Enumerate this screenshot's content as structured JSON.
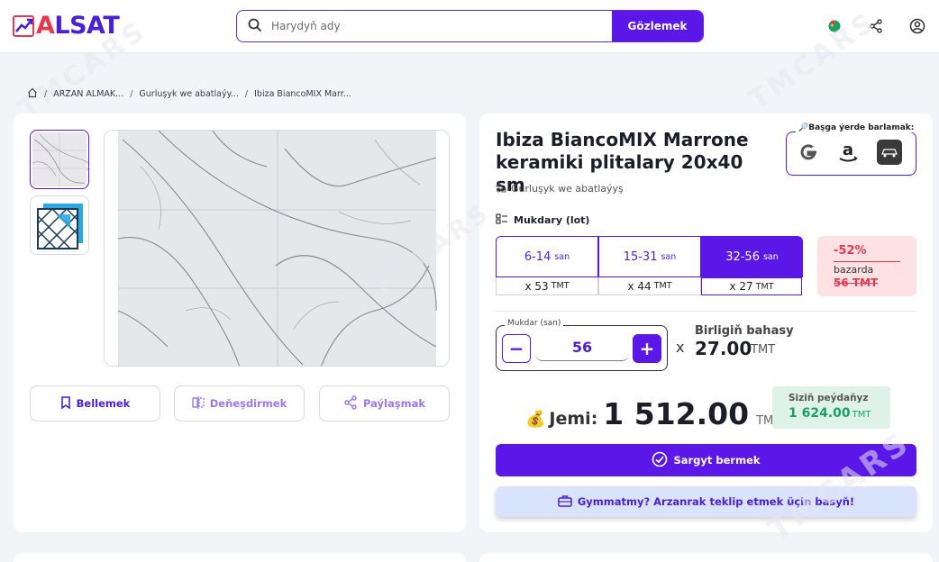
{
  "header": {
    "logo_text": "ALSAT",
    "search_placeholder": "Harydyň ady",
    "search_button": "Gözlemek",
    "brand_color": "#5a17e8",
    "accent_color": "#e63950",
    "icons": [
      "language-flag-icon",
      "share-icon",
      "user-icon"
    ]
  },
  "breadcrumb": {
    "items": [
      "ARZAN ALMAK...",
      "Gurluşyk we abatlaýy...",
      "Ibiza BiancoMIX Marr..."
    ],
    "home_icon": "home-icon"
  },
  "gallery": {
    "thumbnails": [
      "marble-tile-photo",
      "tile-pattern-icon"
    ],
    "actions": [
      {
        "label": "Bellemek",
        "icon": "bookmark-icon"
      },
      {
        "label": "Deňeşdirmek",
        "icon": "compare-icon"
      },
      {
        "label": "Paýlaşmak",
        "icon": "share-icon"
      }
    ]
  },
  "product": {
    "title_line1": "Ibiza BiancoMIX Marrone",
    "title_line2": "keramiki plitalary 20x40 sm",
    "category": "Gurluşyk we abatlaýyş",
    "compare_title": "Başga ýerde barlamak:",
    "compare_sites": [
      "google-icon",
      "amazon-icon",
      "tmcars-icon"
    ]
  },
  "pricing": {
    "qty_title": "Mukdary (lot)",
    "unit_label": "san",
    "currency": "TMT",
    "tiers": [
      {
        "range": "6-14",
        "price_prefix": "x",
        "price": "53",
        "active": false
      },
      {
        "range": "15-31",
        "price_prefix": "x",
        "price": "44",
        "active": false
      },
      {
        "range": "32-56",
        "price_prefix": "x",
        "price": "27",
        "active": true
      }
    ],
    "discount": {
      "percent": "-52%",
      "label": "bazarda",
      "old_price": "56 TMT"
    }
  },
  "quantity": {
    "label": "Mukdar (san)",
    "value": "56",
    "minus": "−",
    "plus": "+",
    "times": "x",
    "unit_price_label": "Birligiň bahasy",
    "unit_price": "27.00",
    "unit_price_currency": "TMT"
  },
  "total": {
    "label": "Jemi:",
    "value": "1 512.00",
    "currency": "TMT",
    "savings_label": "Siziň peýdaňyz",
    "savings_value": "1 624.00",
    "savings_currency": "TMT"
  },
  "buttons": {
    "order": "Sargyt bermek",
    "offer": "Gymmatmy? Arzanrak teklip etmek üçin basyň!"
  }
}
